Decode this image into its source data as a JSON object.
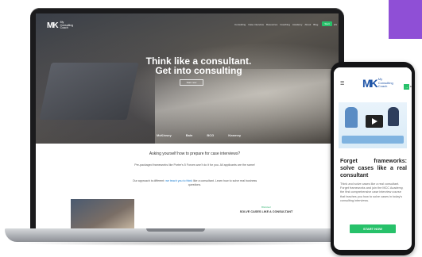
{
  "colors": {
    "accent_green": "#27c16a",
    "brand_blue": "#2156a8",
    "purple": "#8f4fd6",
    "link_blue": "#1f7fd1"
  },
  "desktop": {
    "logo_mark": "MK",
    "logo_text": "My Consulting Coach",
    "nav": [
      "Consulting",
      "Case interview",
      "Resources",
      "Coaching",
      "Academy",
      "About",
      "Blog"
    ],
    "nav_button": "Start",
    "nav_lang": "EN",
    "hero_title_line1": "Think like a consultant.",
    "hero_title_line2": "Get into consulting",
    "hero_cta": "Start now",
    "hero_logos": [
      "McKinsey",
      "Bain",
      "BCG",
      "Kearney"
    ],
    "question_title": "Asking yourself how to prepare for case interviews?",
    "paragraph1": "Pre-packaged frameworks like Porter's 5 Forces won't do it for you. All applicants are the same!",
    "paragraph2_pre": "Our approach is different:",
    "paragraph2_highlight": "we teach you to think",
    "paragraph2_post": "like a consultant. Learn how to solve real business questions.",
    "case_label": "Discover",
    "case_title": "SOLVE CASES LIKE A CONSULTANT"
  },
  "mobile": {
    "menu_icon": "☰",
    "logo_mark": "MK",
    "logo_text": "My Consulting Coach",
    "header_button": "→",
    "header_lang": "EN",
    "title": "Forget frameworks: solve cases like a real consultant",
    "body": "Think and solve cases like a real consultant. Forget frameworks and join the MCC Academy, the first comprehensive case interview course that teaches you how to solve cases in today's consulting interviews.",
    "cta": "START NOW"
  }
}
